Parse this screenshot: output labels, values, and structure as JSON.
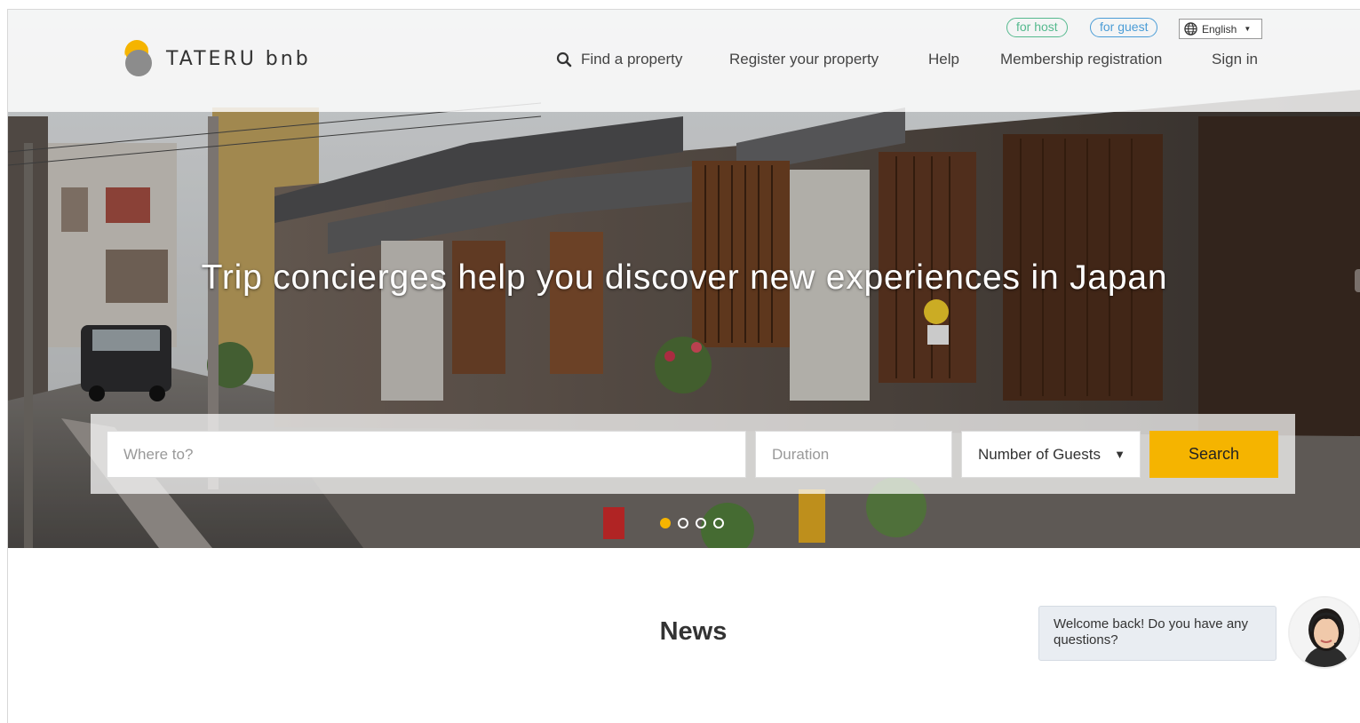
{
  "header": {
    "logo_text": "TATERU bnb",
    "for_host": "for host",
    "for_guest": "for guest",
    "language": "English",
    "nav": [
      {
        "label": "Find a property",
        "icon": "search-icon"
      },
      {
        "label": "Register your property"
      },
      {
        "label": "Help"
      },
      {
        "label": "Membership registration"
      },
      {
        "label": "Sign in"
      }
    ]
  },
  "hero": {
    "headline": "Trip concierges help you discover new experiences in Japan"
  },
  "search": {
    "where_placeholder": "Where to?",
    "duration_placeholder": "Duration",
    "guests_label": "Number of Guests",
    "button": "Search"
  },
  "carousel": {
    "slides": 4,
    "active_index": 0
  },
  "news": {
    "title": "News"
  },
  "chat": {
    "message": "Welcome back! Do you have any questions?"
  },
  "colors": {
    "accent": "#f5b400",
    "host_pill": "#55b98e",
    "guest_pill": "#4a9cd6"
  }
}
